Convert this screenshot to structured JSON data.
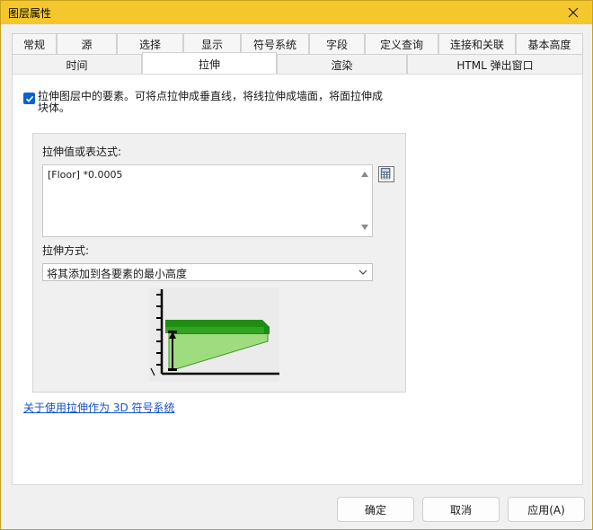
{
  "window": {
    "title": "图层属性"
  },
  "tabs_row1": [
    "常规",
    "源",
    "选择",
    "显示",
    "符号系统",
    "字段",
    "定义查询",
    "连接和关联",
    "基本高度"
  ],
  "tabs_row2": [
    "时间",
    "拉伸",
    "渲染",
    "HTML 弹出窗口"
  ],
  "active_tab": "拉伸",
  "extrude": {
    "checkbox_checked": true,
    "checkbox_label": "拉伸图层中的要素。可将点拉伸成垂直线，将线拉伸成墙面，将面拉伸成块体。",
    "value_label": "拉伸值或表达式:",
    "value_expression": "[Floor] *0.0005",
    "method_label": "拉伸方式:",
    "method_selected": "将其添加到各要素的最小高度"
  },
  "help_link": "关于使用拉伸作为 3D 符号系统",
  "buttons": {
    "ok": "确定",
    "cancel": "取消",
    "apply": "应用(A)"
  },
  "icons": {
    "close": "close-icon",
    "checkmark": "checkmark-icon",
    "expression_builder": "calculator-icon",
    "dropdown": "chevron-down-icon"
  },
  "colors": {
    "titlebar": "#f4c82c",
    "checkbox": "#0a64c8",
    "link": "#1452c8",
    "extrude_dark_green": "#1a8a10",
    "extrude_light_green": "#a8e08a"
  }
}
